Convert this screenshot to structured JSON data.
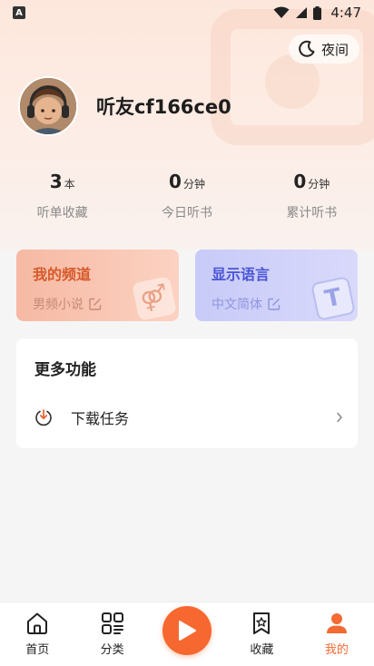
{
  "status_bar": {
    "time": "4:47",
    "app_icon_letter": "A"
  },
  "night_toggle": {
    "label": "夜间"
  },
  "profile": {
    "username": "听友cf166ce0"
  },
  "stats": [
    {
      "value": "3",
      "unit": "本",
      "caption": "听单收藏"
    },
    {
      "value": "0",
      "unit": "分钟",
      "caption": "今日听书"
    },
    {
      "value": "0",
      "unit": "分钟",
      "caption": "累计听书"
    }
  ],
  "cards": {
    "channel": {
      "title": "我的频道",
      "subtitle": "男频小说",
      "badge_glyph": "⚤"
    },
    "language": {
      "title": "显示语言",
      "subtitle": "中文简体",
      "badge_glyph": "T"
    }
  },
  "more_functions": {
    "title": "更多功能",
    "items": [
      {
        "label": "下载任务",
        "icon": "download-icon"
      }
    ]
  },
  "bottom_nav": [
    {
      "label": "首页",
      "icon": "home-icon"
    },
    {
      "label": "分类",
      "icon": "category-icon"
    },
    {
      "label": "收藏",
      "icon": "bookmark-icon"
    },
    {
      "label": "我的",
      "icon": "user-icon",
      "active": true
    }
  ],
  "colors": {
    "accent": "#f6682f",
    "channel_title": "#d65a2a",
    "language_title": "#4a55d6"
  }
}
